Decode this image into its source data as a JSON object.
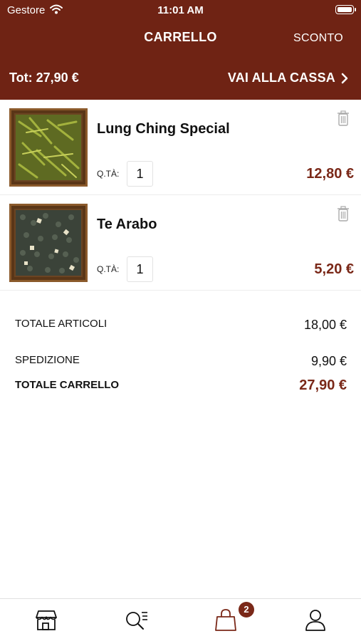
{
  "status": {
    "carrier": "Gestore",
    "time": "11:01 AM"
  },
  "nav": {
    "title": "CARRELLO",
    "right_action": "SCONTO"
  },
  "summary_bar": {
    "total_label": "Tot: 27,90 €",
    "checkout_label": "VAI ALLA CASSA"
  },
  "cart": {
    "items": [
      {
        "name": "Lung Ching Special",
        "qty_label": "Q.TÀ:",
        "qty": "1",
        "price": "12,80 €",
        "image": "green-tea-leaves"
      },
      {
        "name": "Te Arabo",
        "qty_label": "Q.TÀ:",
        "qty": "1",
        "price": "5,20 €",
        "image": "gunpowder-tea-mint"
      }
    ]
  },
  "totals": {
    "articles_label": "TOTALE ARTICOLI",
    "articles_value": "18,00 €",
    "shipping_label": "SPEDIZIONE",
    "shipping_value": "9,90 €",
    "cart_total_label": "TOTALE CARRELLO",
    "cart_total_value": "27,90 €"
  },
  "tabbar": {
    "tabs": [
      {
        "icon": "shop-icon",
        "active": false
      },
      {
        "icon": "search-list-icon",
        "active": false
      },
      {
        "icon": "bag-icon",
        "active": true
      },
      {
        "icon": "user-icon",
        "active": false
      }
    ],
    "cart_badge": "2"
  },
  "colors": {
    "brand": "#6f2314",
    "price": "#7a2818"
  }
}
